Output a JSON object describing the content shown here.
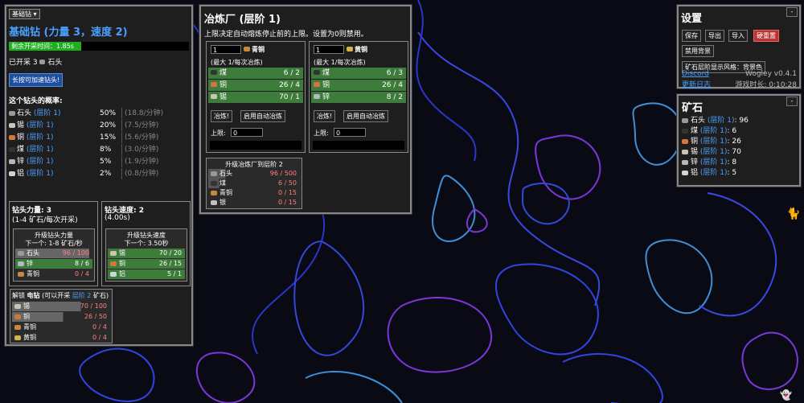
{
  "colors": {
    "bar_green": "#1fae1f",
    "row_green": "#3d7c3a",
    "row_gray": "#5a5a5a",
    "red_btn": "#b83333",
    "blue_btn": "#1e4fa0",
    "link": "#4aa0ff"
  },
  "drill": {
    "select": "基础钻",
    "title": "基础钻 (力量 3，速度 2)",
    "timer": "剩余开采时间：1.85s",
    "timer_fraction": 0.4,
    "mined_label": "已开采 3",
    "mined_ore": "石头",
    "hold_button": "长按可加速钻头!",
    "prob_header": "这个钻头的概率:",
    "probs": [
      {
        "ore": "石头",
        "level": "(层阶 1)",
        "pct": "50%",
        "rate": "(18.8/分钟)"
      },
      {
        "ore": "锡",
        "level": "(层阶 1)",
        "pct": "20%",
        "rate": "(7.5/分钟)"
      },
      {
        "ore": "铜",
        "level": "(层阶 1)",
        "pct": "15%",
        "rate": "(5.6/分钟)"
      },
      {
        "ore": "煤",
        "level": "(层阶 1)",
        "pct": "8%",
        "rate": "(3.0/分钟)"
      },
      {
        "ore": "锌",
        "level": "(层阶 1)",
        "pct": "5%",
        "rate": "(1.9/分钟)"
      },
      {
        "ore": "铝",
        "level": "(层阶 1)",
        "pct": "2%",
        "rate": "(0.8/分钟)"
      }
    ],
    "power": {
      "title": "钻头力量: 3",
      "sub": "(1-4 矿石/每次开采)",
      "up_title": "升级钻头力量",
      "up_next": "下一个: 1-8 矿石/秒",
      "rows": [
        {
          "name": "石头",
          "value": "96 / 100",
          "ok": false
        },
        {
          "name": "锌",
          "value": "8 / 6",
          "ok": true
        },
        {
          "name": "青铜",
          "value": "0 / 4",
          "ok": false
        }
      ]
    },
    "speed": {
      "title": "钻头速度: 2",
      "sub": "(4.00s)",
      "up_title": "升级钻头速度",
      "up_next": "下一个: 3.50秒",
      "rows": [
        {
          "name": "锡",
          "value": "70 / 20",
          "ok": true
        },
        {
          "name": "铜",
          "value": "26 / 15",
          "ok": true
        },
        {
          "name": "铝",
          "value": "5 / 1",
          "ok": true
        }
      ]
    },
    "unlock": {
      "prefix": "解锁",
      "name": "电钻",
      "note": "(可以开采",
      "level": "层阶 2",
      "note2": "矿石)",
      "rows": [
        {
          "name": "锡",
          "value": "70 / 100",
          "ok": false
        },
        {
          "name": "铜",
          "value": "26 / 50",
          "ok": false
        },
        {
          "name": "青铜",
          "value": "0 / 4",
          "ok": false
        },
        {
          "name": "黄铜",
          "value": "0 / 4",
          "ok": false
        }
      ]
    }
  },
  "smelter": {
    "title": "冶炼厂 (层阶 1)",
    "desc": "上限决定自动熔炼停止前的上限。设置为0则禁用。",
    "units": [
      {
        "qty": "1",
        "product": "青铜",
        "max": "(最大 1/每次冶炼)",
        "rows": [
          {
            "name": "煤",
            "value": "6 / 2"
          },
          {
            "name": "铜",
            "value": "26 / 4"
          },
          {
            "name": "锡",
            "value": "70 / 1"
          }
        ],
        "smelt": "冶炼!",
        "auto": "启用自动冶炼",
        "limit_label": "上限:",
        "limit": "0"
      },
      {
        "qty": "1",
        "product": "黄铜",
        "max": "(最大 1/每次冶炼)",
        "rows": [
          {
            "name": "煤",
            "value": "6 / 3"
          },
          {
            "name": "铜",
            "value": "26 / 4"
          },
          {
            "name": "锌",
            "value": "8 / 2"
          }
        ],
        "smelt": "冶炼!",
        "auto": "启用自动冶炼",
        "limit_label": "上限:",
        "limit": "0"
      }
    ],
    "upgrade": {
      "title": "升级冶炼厂到层阶 2",
      "rows": [
        {
          "name": "石头",
          "value": "96 / 500"
        },
        {
          "name": "煤",
          "value": "6 / 50"
        },
        {
          "name": "青铜",
          "value": "0 / 15"
        },
        {
          "name": "银",
          "value": "0 / 15"
        }
      ]
    }
  },
  "settings": {
    "title": "设置",
    "close": "-",
    "buttons": [
      "保存",
      "导出",
      "导入",
      "硬重置"
    ],
    "disable_bg": "禁用背景",
    "ore_style": "矿石层阶显示风格：背景色",
    "discord": "Discord",
    "version": "Wogley v0.4.1",
    "changelog": "更新日志",
    "playtime": "游戏时长: 0:10:28"
  },
  "ores": {
    "title": "矿石",
    "close": "-",
    "items": [
      {
        "name": "石头",
        "level": "(层阶 1)",
        "count": "96"
      },
      {
        "name": "煤",
        "level": "(层阶 1)",
        "count": "6"
      },
      {
        "name": "铜",
        "level": "(层阶 1)",
        "count": "26"
      },
      {
        "name": "锡",
        "level": "(层阶 1)",
        "count": "70"
      },
      {
        "name": "锌",
        "level": "(层阶 1)",
        "count": "8"
      },
      {
        "name": "铝",
        "level": "(层阶 1)",
        "count": "5"
      }
    ]
  },
  "icons": {
    "stone": "#9a9a9a",
    "coal": "#333",
    "copper": "#d2763c",
    "tin": "#c9c6b8",
    "zinc": "#b0b8c0",
    "aluminium": "#cfd4d8",
    "bronze": "#c88a3a",
    "brass": "#d8b048",
    "silver": "#c0c0c0"
  }
}
